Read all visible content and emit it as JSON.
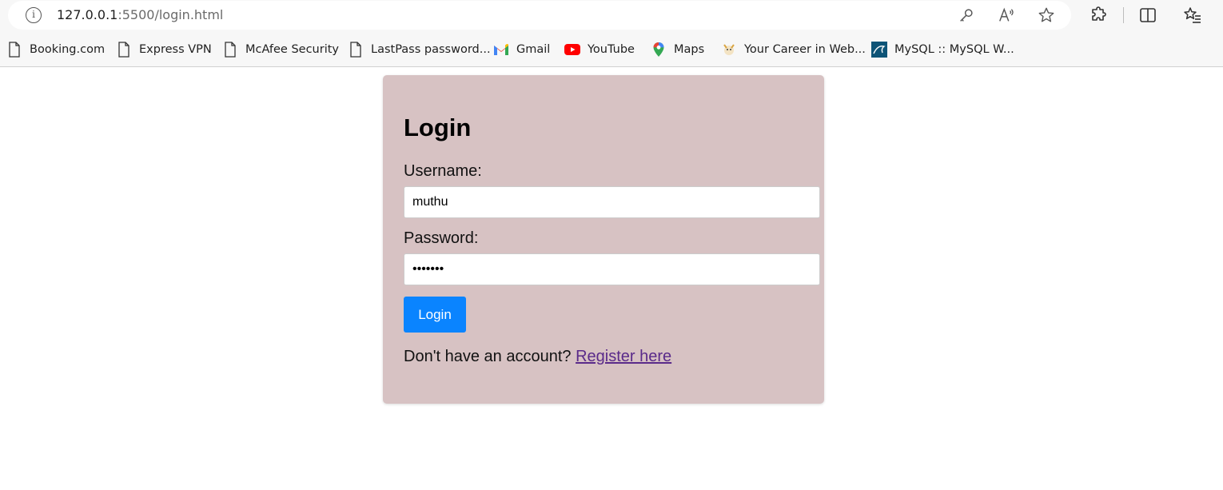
{
  "browser": {
    "url_host": "127.0.0.1",
    "url_path": ":5500/login.html",
    "toolbar_icons": [
      "key-icon",
      "read-aloud-icon",
      "star-icon",
      "extensions-icon",
      "split-screen-icon",
      "favorites-icon"
    ]
  },
  "bookmarks": [
    {
      "label": "Booking.com",
      "icon": "page-icon"
    },
    {
      "label": "Express VPN",
      "icon": "page-icon"
    },
    {
      "label": "McAfee Security",
      "icon": "page-icon"
    },
    {
      "label": "LastPass password...",
      "icon": "page-icon"
    },
    {
      "label": "Gmail",
      "icon": "gmail-icon"
    },
    {
      "label": "YouTube",
      "icon": "youtube-icon"
    },
    {
      "label": "Maps",
      "icon": "maps-icon"
    },
    {
      "label": "Your Career in Web...",
      "icon": "career-icon"
    },
    {
      "label": "MySQL :: MySQL W...",
      "icon": "mysql-icon"
    }
  ],
  "login": {
    "title": "Login",
    "username_label": "Username:",
    "username_value": "muthu",
    "password_label": "Password:",
    "password_value": "1234567",
    "button_label": "Login",
    "register_prompt": "Don't have an account?",
    "register_link": "Register here"
  },
  "colors": {
    "card_bg": "#d7c2c3",
    "button_bg": "#0a84ff",
    "link": "#5a2a8a"
  }
}
